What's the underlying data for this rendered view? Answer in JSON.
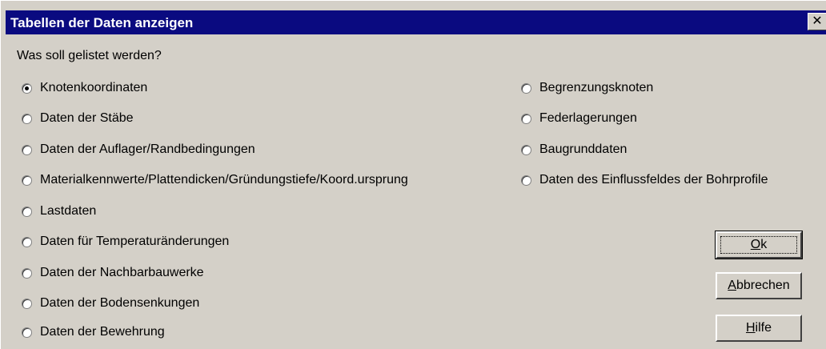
{
  "window": {
    "title": "Tabellen der Daten anzeigen",
    "close_glyph": "✕"
  },
  "prompt": "Was soll gelistet werden?",
  "options_left": [
    {
      "label": "Knotenkoordinaten",
      "selected": true
    },
    {
      "label": "Daten der Stäbe",
      "selected": false
    },
    {
      "label": "Daten der Auflager/Randbedingungen",
      "selected": false
    },
    {
      "label": "Materialkennwerte/Plattendicken/Gründungstiefe/Koord.ursprung",
      "selected": false
    },
    {
      "label": "Lastdaten",
      "selected": false
    },
    {
      "label": "Daten für Temperaturänderungen",
      "selected": false
    },
    {
      "label": "Daten der Nachbarbauwerke",
      "selected": false
    },
    {
      "label": "Daten der Bodensenkungen",
      "selected": false
    },
    {
      "label": "Daten der Bewehrung",
      "selected": false
    }
  ],
  "options_right": [
    {
      "label": "Begrenzungsknoten",
      "selected": false
    },
    {
      "label": "Federlagerungen",
      "selected": false
    },
    {
      "label": "Baugrunddaten",
      "selected": false
    },
    {
      "label": "Daten des Einflussfeldes der Bohrprofile",
      "selected": false
    }
  ],
  "buttons": {
    "ok": {
      "mnemonic": "O",
      "rest": "k"
    },
    "cancel": {
      "mnemonic": "A",
      "rest": "bbrechen"
    },
    "help": {
      "mnemonic": "H",
      "rest": "ilfe"
    }
  },
  "colors": {
    "titlebar": "#0a0a80",
    "face": "#d4d0c8"
  }
}
